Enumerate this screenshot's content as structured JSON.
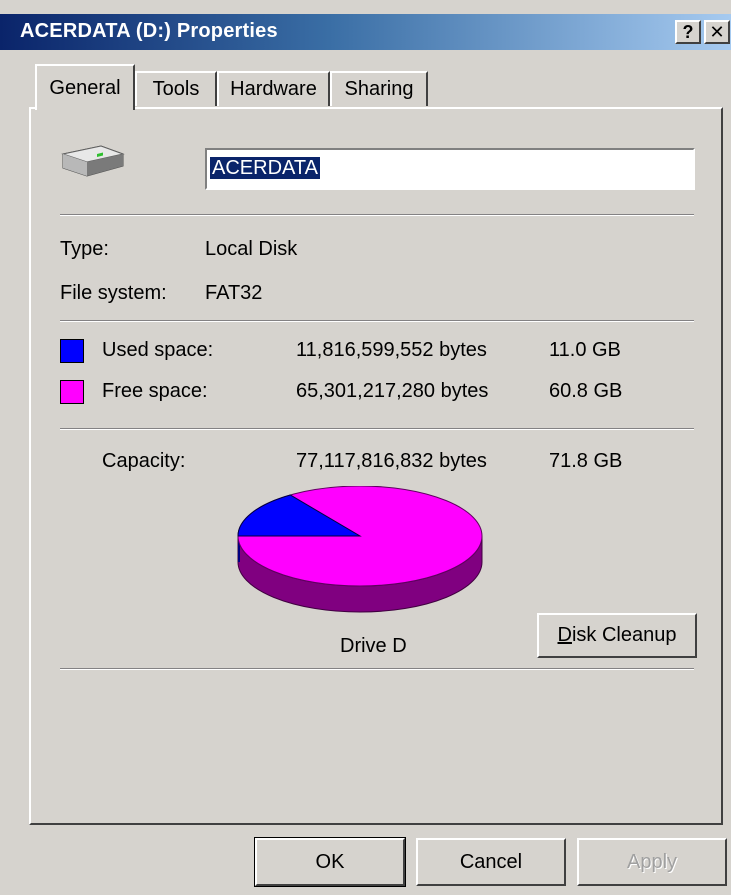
{
  "window": {
    "title": "ACERDATA (D:) Properties",
    "help_label": "?",
    "close_label": "✕"
  },
  "tabs": [
    {
      "label": "General",
      "active": true
    },
    {
      "label": "Tools",
      "active": false
    },
    {
      "label": "Hardware",
      "active": false
    },
    {
      "label": "Sharing",
      "active": false
    }
  ],
  "general": {
    "drive_icon": "hard-drive-icon",
    "name_value": "ACERDATA",
    "type_label": "Type:",
    "type_value": "Local Disk",
    "fs_label": "File system:",
    "fs_value": "FAT32",
    "used": {
      "label": "Used space:",
      "bytes": "11,816,599,552 bytes",
      "size": "11.0 GB",
      "color": "#0000ff"
    },
    "free": {
      "label": "Free space:",
      "bytes": "65,301,217,280 bytes",
      "size": "60.8 GB",
      "color": "#ff00ff"
    },
    "capacity": {
      "label": "Capacity:",
      "bytes": "77,117,816,832 bytes",
      "size": "71.8 GB"
    },
    "pie": {
      "used_fraction": 0.1532,
      "used_color": "#0000ff",
      "used_side_color": "#000080",
      "free_color": "#ff00ff",
      "free_side_color": "#800080"
    },
    "drive_label": "Drive D",
    "cleanup_label": "Disk Cleanup",
    "cleanup_mnemonic": "D",
    "cleanup_rest": "isk Cleanup"
  },
  "buttons": {
    "ok": "OK",
    "cancel": "Cancel",
    "apply": "Apply"
  }
}
